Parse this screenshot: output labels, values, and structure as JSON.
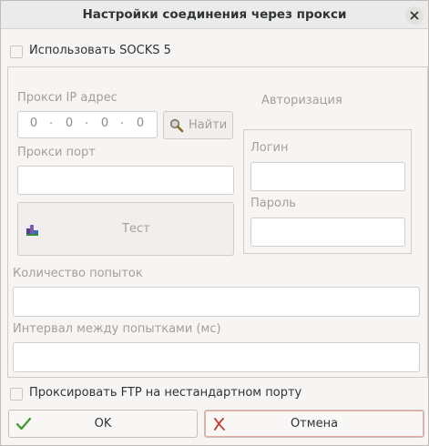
{
  "window": {
    "title": "Настройки соединения через прокси"
  },
  "socks": {
    "label": "Использовать SOCKS 5",
    "checked": false
  },
  "proxy_ip": {
    "label": "Прокси IP адрес",
    "octets": [
      "0",
      "0",
      "0",
      "0"
    ],
    "separator": "."
  },
  "find_button": {
    "label": "Найти",
    "icon": "magnifier-icon"
  },
  "proxy_port": {
    "label": "Прокси порт",
    "value": ""
  },
  "test_button": {
    "label": "Тест",
    "icon": "network-test-icon"
  },
  "auth": {
    "title": "Авторизация",
    "login_label": "Логин",
    "login_value": "",
    "password_label": "Пароль",
    "password_value": ""
  },
  "retries": {
    "label": "Количество попыток",
    "value": ""
  },
  "interval": {
    "label": "Интервал между попытками (мс)",
    "value": ""
  },
  "ftp": {
    "label": "Проксировать FTP на нестандартном порту",
    "checked": false
  },
  "buttons": {
    "ok": "OK",
    "cancel": "Отмена"
  },
  "colors": {
    "ok_icon": "#3a9a2a",
    "cancel_icon": "#c0392b",
    "disabled_text": "#a3a09b"
  }
}
